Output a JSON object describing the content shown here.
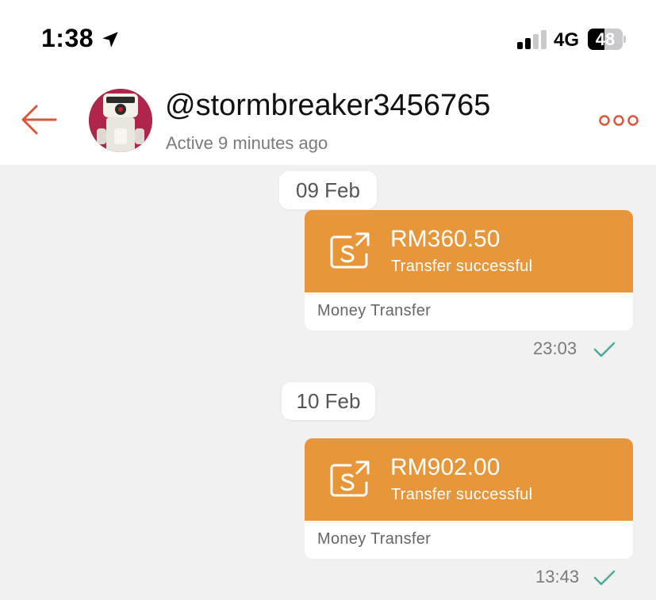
{
  "status_bar": {
    "time": "1:38",
    "network": "4G",
    "battery": "48",
    "battery_level": 0.48,
    "icons": [
      "location-arrow-icon",
      "signal-icon",
      "battery-icon"
    ]
  },
  "header": {
    "username": "@stormbreaker3456765",
    "active_status": "Active 9 minutes ago",
    "icons": [
      "back-arrow-icon",
      "more-options-icon"
    ]
  },
  "messages": [
    {
      "date": "09 Feb",
      "amount": "RM360.50",
      "status": "Transfer successful",
      "footer": "Money Transfer",
      "time": "23:03"
    },
    {
      "date": "10 Feb",
      "amount": "RM902.00",
      "status": "Transfer successful",
      "footer": "Money Transfer",
      "time": "13:43"
    }
  ],
  "colors": {
    "accent": "#e8963a",
    "icon_accent": "#d9573a",
    "check": "#4fa89e",
    "background": "#f1f1f1"
  }
}
